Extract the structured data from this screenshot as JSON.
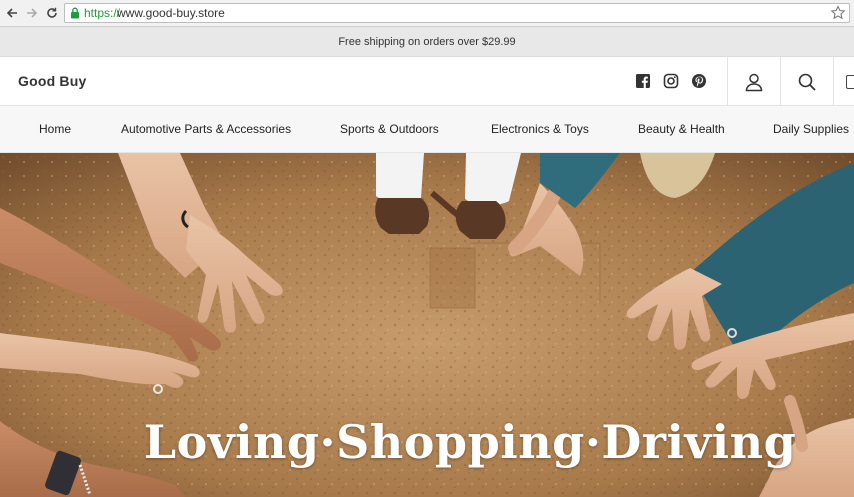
{
  "browser": {
    "url_scheme": "https://",
    "url_host": "www.good-buy.store"
  },
  "announcement": "Free shipping on orders over $29.99",
  "header": {
    "logo": "Good Buy",
    "social": [
      "facebook-icon",
      "instagram-icon",
      "pinterest-icon"
    ]
  },
  "menu": {
    "items": [
      {
        "label": "Home"
      },
      {
        "label": "Automotive Parts & Accessories"
      },
      {
        "label": "Sports & Outdoors"
      },
      {
        "label": "Electronics & Toys"
      },
      {
        "label": "Beauty & Health"
      },
      {
        "label": "Daily Supplies"
      }
    ]
  },
  "hero": {
    "title": "Loving·Shopping·Driving"
  },
  "colors": {
    "secure_green": "#1f9c3c",
    "announce_bg": "#e8e8e8",
    "cork": "#b58a5c"
  }
}
